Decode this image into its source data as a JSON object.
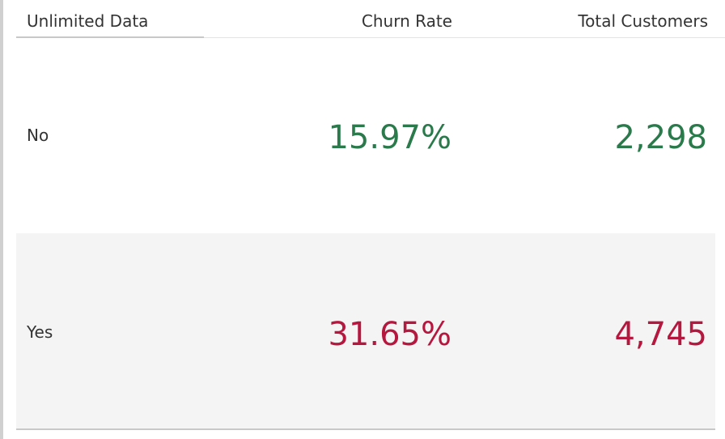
{
  "chart_data": {
    "type": "table",
    "columns": [
      "Unlimited Data",
      "Churn Rate",
      "Total Customers"
    ],
    "rows": [
      {
        "category": "No",
        "churn_rate": "15.97%",
        "total_customers": "2,298",
        "color": "#2a7a4b"
      },
      {
        "category": "Yes",
        "churn_rate": "31.65%",
        "total_customers": "4,745",
        "color": "#b5173f"
      }
    ]
  },
  "colors": {
    "positive": "#2a7a4b",
    "negative": "#b5173f",
    "header_text": "#333333",
    "band": "#f4f4f4"
  }
}
